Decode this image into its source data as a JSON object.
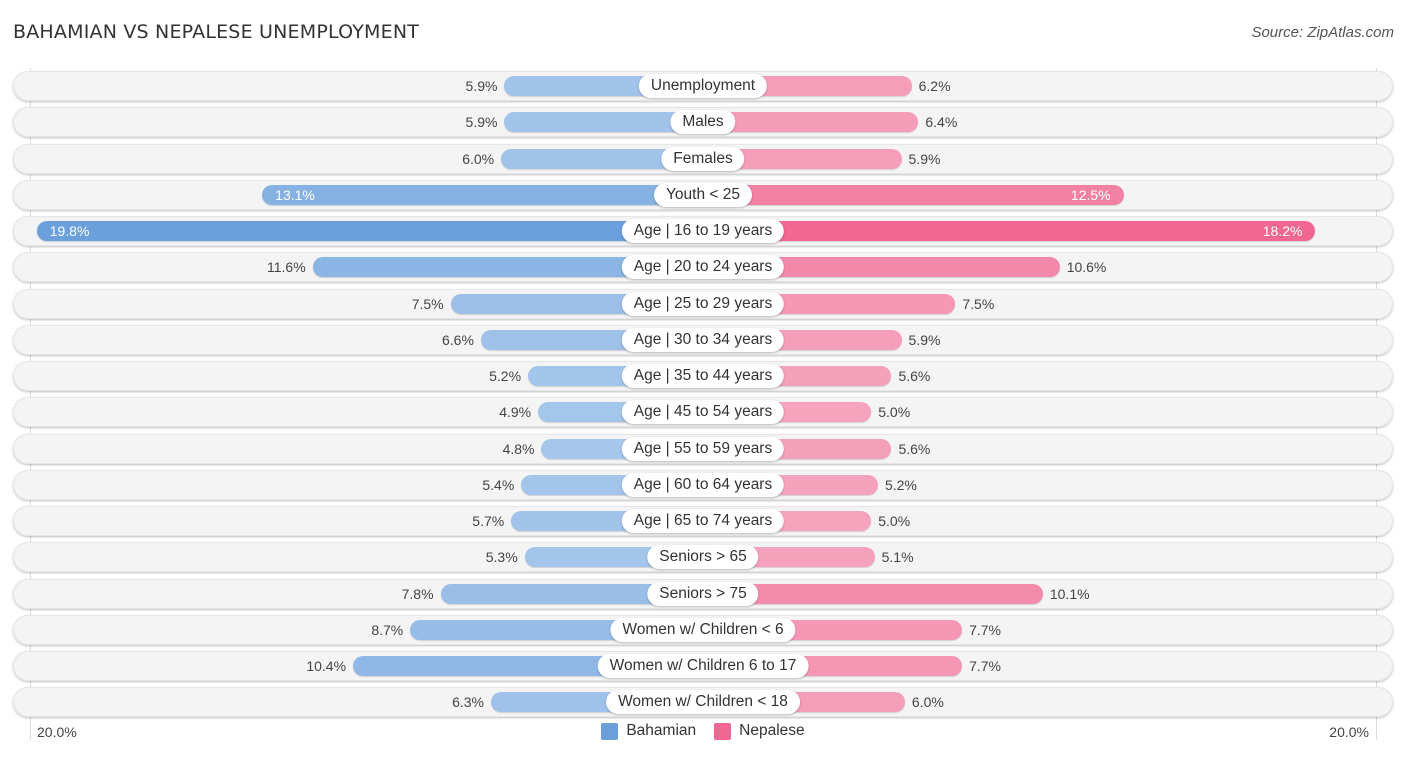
{
  "header": {
    "title": "BAHAMIAN VS NEPALESE UNEMPLOYMENT",
    "source": "Source: ZipAtlas.com"
  },
  "colors": {
    "bahamian_strong": "#6a9fdc",
    "bahamian_light": "#a9c8ec",
    "nepalese_strong": "#f06892",
    "nepalese_light": "#f6a7c0"
  },
  "chart_data": {
    "type": "bar",
    "orientation": "horizontal-diverging",
    "title": "BAHAMIAN VS NEPALESE UNEMPLOYMENT",
    "xlabel": "",
    "ylabel": "",
    "xlim": [
      -20,
      20
    ],
    "axis_labels": {
      "left": "20.0%",
      "right": "20.0%"
    },
    "legend_position": "bottom-center",
    "grid": false,
    "categories": [
      "Unemployment",
      "Males",
      "Females",
      "Youth < 25",
      "Age | 16 to 19 years",
      "Age | 20 to 24 years",
      "Age | 25 to 29 years",
      "Age | 30 to 34 years",
      "Age | 35 to 44 years",
      "Age | 45 to 54 years",
      "Age | 55 to 59 years",
      "Age | 60 to 64 years",
      "Age | 65 to 74 years",
      "Seniors > 65",
      "Seniors > 75",
      "Women w/ Children < 6",
      "Women w/ Children 6 to 17",
      "Women w/ Children < 18"
    ],
    "series": [
      {
        "name": "Bahamian",
        "side": "left",
        "values": [
          5.9,
          5.9,
          6.0,
          13.1,
          19.8,
          11.6,
          7.5,
          6.6,
          5.2,
          4.9,
          4.8,
          5.4,
          5.7,
          5.3,
          7.8,
          8.7,
          10.4,
          6.3
        ],
        "labels": [
          "5.9%",
          "5.9%",
          "6.0%",
          "13.1%",
          "19.8%",
          "11.6%",
          "7.5%",
          "6.6%",
          "5.2%",
          "4.9%",
          "4.8%",
          "5.4%",
          "5.7%",
          "5.3%",
          "7.8%",
          "8.7%",
          "10.4%",
          "6.3%"
        ]
      },
      {
        "name": "Nepalese",
        "side": "right",
        "values": [
          6.2,
          6.4,
          5.9,
          12.5,
          18.2,
          10.6,
          7.5,
          5.9,
          5.6,
          5.0,
          5.6,
          5.2,
          5.0,
          5.1,
          10.1,
          7.7,
          7.7,
          6.0
        ],
        "labels": [
          "6.2%",
          "6.4%",
          "5.9%",
          "12.5%",
          "18.2%",
          "10.6%",
          "7.5%",
          "5.9%",
          "5.6%",
          "5.0%",
          "5.6%",
          "5.2%",
          "5.0%",
          "5.1%",
          "10.1%",
          "7.7%",
          "7.7%",
          "6.0%"
        ]
      }
    ]
  },
  "legend": {
    "items": [
      {
        "label": "Bahamian",
        "color": "#6a9fdc"
      },
      {
        "label": "Nepalese",
        "color": "#f06892"
      }
    ]
  }
}
